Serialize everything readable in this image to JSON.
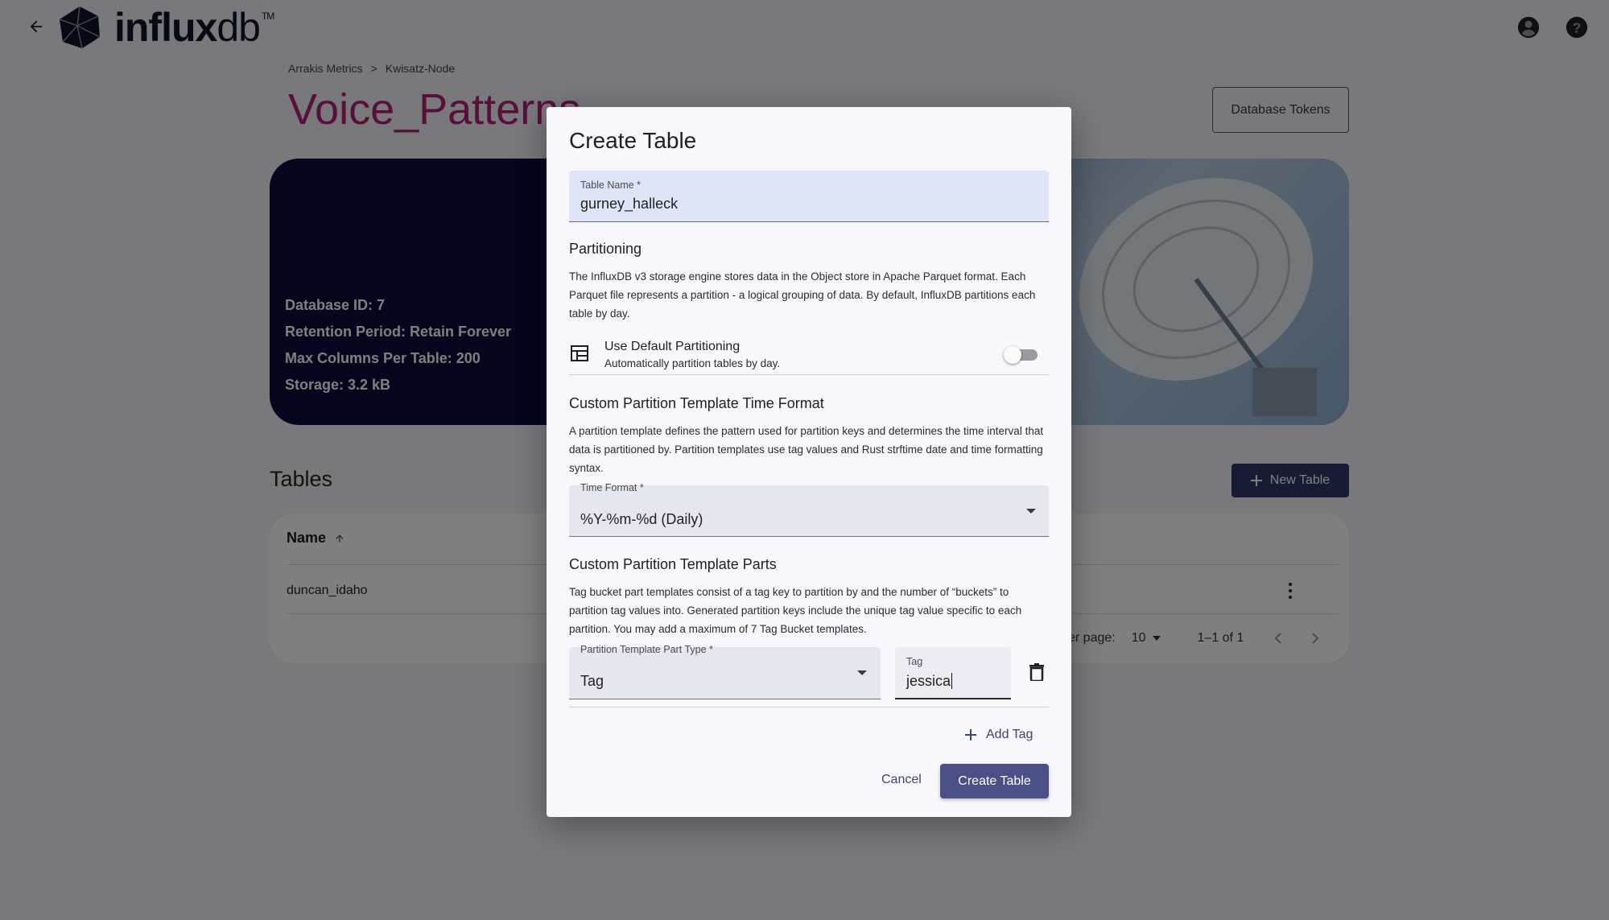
{
  "app": {
    "logo_text_bold": "influx",
    "logo_text_light": "db",
    "logo_tm": "TM"
  },
  "breadcrumb": {
    "items": [
      "Arrakis Metrics",
      "Kwisatz-Node"
    ],
    "separator": ">"
  },
  "page": {
    "title": "Voice_Patterns",
    "database_tokens_label": "Database Tokens"
  },
  "hero": {
    "database_id": "Database ID: 7",
    "retention": "Retention Period: Retain Forever",
    "max_columns": "Max Columns Per Table: 200",
    "storage": "Storage: 3.2 kB"
  },
  "tables": {
    "title": "Tables",
    "new_table_label": "New Table",
    "column_name": "Name",
    "rows": [
      {
        "name": "duncan_idaho"
      }
    ],
    "rows_per_page_label": "er page:",
    "rows_per_page_value": "10",
    "range": "1–1 of 1"
  },
  "dialog": {
    "title": "Create Table",
    "table_name": {
      "label": "Table Name *",
      "value": "gurney_halleck"
    },
    "partitioning": {
      "title": "Partitioning",
      "description": "The InfluxDB v3 storage engine stores data in the Object store in Apache Parquet format. Each Parquet file represents a partition - a logical grouping of data. By default, InfluxDB partitions each table by day.",
      "default_title": "Use Default Partitioning",
      "default_subtitle": "Automatically partition tables by day.",
      "default_enabled": false
    },
    "time_format": {
      "title": "Custom Partition Template Time Format",
      "description": "A partition template defines the pattern used for partition keys and determines the time interval that data is partitioned by. Partition templates use tag values and Rust strftime date and time formatting syntax.",
      "label": "Time Format *",
      "value": "%Y-%m-%d (Daily)"
    },
    "parts": {
      "title": "Custom Partition Template Parts",
      "description": "Tag bucket part templates consist of a tag key to partition by and the number of “buckets” to partition tag values into. Generated partition keys include the unique tag value specific to each partition. You may add a maximum of 7 Tag Bucket templates.",
      "part_type_label": "Partition Template Part Type *",
      "part_type_value": "Tag",
      "tag_label": "Tag",
      "tag_value": "jessica",
      "add_tag_label": "Add Tag"
    },
    "cancel_label": "Cancel",
    "create_label": "Create Table"
  }
}
